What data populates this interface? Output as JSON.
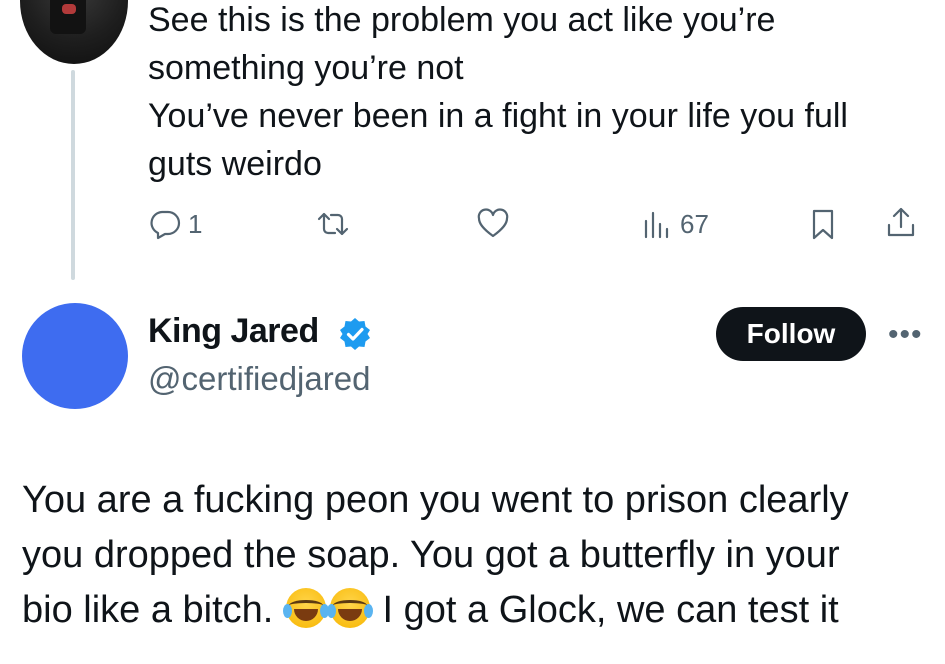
{
  "parent_tweet": {
    "text_lines": [
      "See this is the problem you act like you’re",
      "something you’re not",
      "You’ve never been in a fight in your life you full",
      "guts weirdo"
    ],
    "actions": {
      "reply_count": "1",
      "views_count": "67"
    }
  },
  "reply_tweet": {
    "display_name": "King Jared",
    "handle": "@certifiedjared",
    "follow_label": "Follow",
    "more_label": "•••",
    "avatar_color": "#3e6cf0",
    "verified_color": "#1d9bf0",
    "text": {
      "line1": "You are a fucking peon you went to prison clearly",
      "line2": "you dropped the soap. You got a butterfly in your",
      "line3_before_emoji": "bio like a bitch.",
      "emoji": "face-with-tears-of-joy",
      "line3_after_emoji": "I got a Glock, we can test it"
    }
  }
}
